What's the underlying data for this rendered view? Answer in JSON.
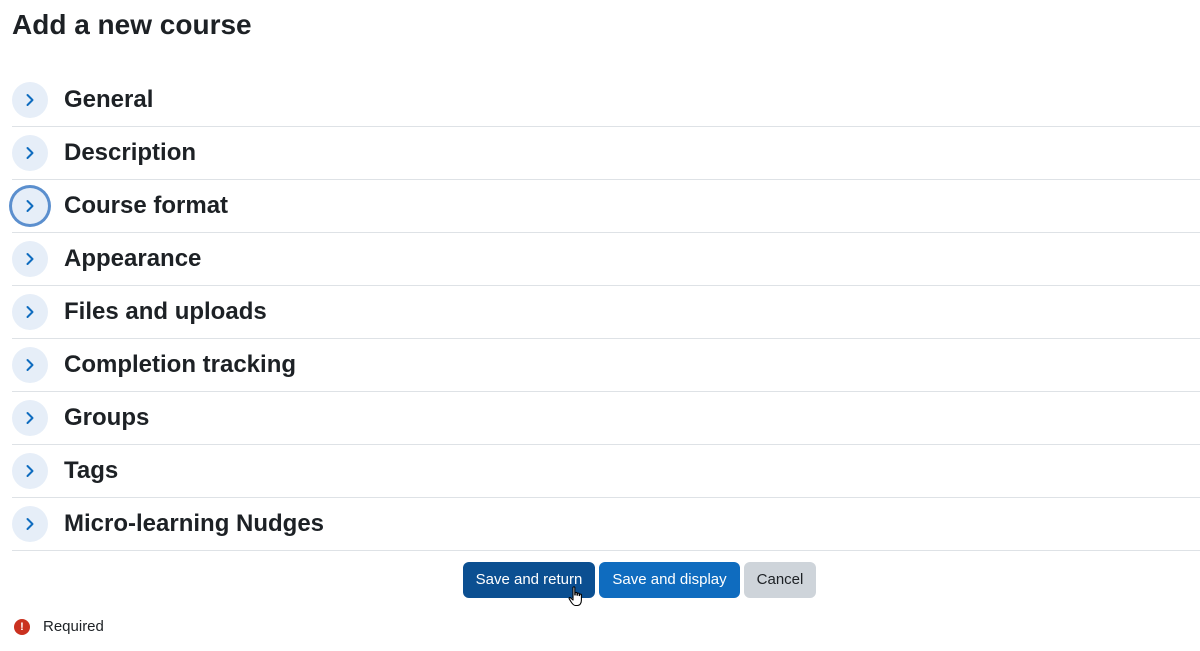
{
  "page": {
    "title": "Add a new course"
  },
  "sections": [
    {
      "label": "General",
      "focused": false
    },
    {
      "label": "Description",
      "focused": false
    },
    {
      "label": "Course format",
      "focused": true
    },
    {
      "label": "Appearance",
      "focused": false
    },
    {
      "label": "Files and uploads",
      "focused": false
    },
    {
      "label": "Completion tracking",
      "focused": false
    },
    {
      "label": "Groups",
      "focused": false
    },
    {
      "label": "Tags",
      "focused": false
    },
    {
      "label": "Micro-learning Nudges",
      "focused": false
    }
  ],
  "actions": {
    "save_return_label": "Save and return",
    "save_display_label": "Save and display",
    "cancel_label": "Cancel"
  },
  "footer": {
    "required_icon": "!",
    "required_label": "Required"
  },
  "colors": {
    "primary": "#0f6cbf",
    "primary_dark": "#0b4f91",
    "secondary": "#ced4da",
    "required": "#ca3120",
    "chevron": "#0f6cbf"
  },
  "icons": {
    "section_toggle": "chevron-right-icon",
    "required": "exclamation-circle-icon",
    "cursor": "hand-pointer-cursor"
  }
}
